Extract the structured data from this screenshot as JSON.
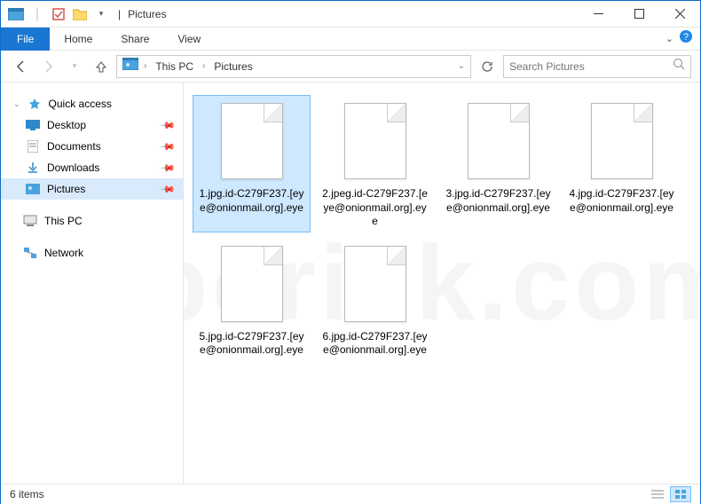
{
  "window": {
    "title": "Pictures",
    "title_sep": "|"
  },
  "ribbon": {
    "file": "File",
    "tabs": [
      "Home",
      "Share",
      "View"
    ]
  },
  "address": {
    "segments": [
      "This PC",
      "Pictures"
    ]
  },
  "search": {
    "placeholder": "Search Pictures"
  },
  "nav": {
    "quick_access": "Quick access",
    "items": [
      {
        "label": "Desktop",
        "pinned": true
      },
      {
        "label": "Documents",
        "pinned": true
      },
      {
        "label": "Downloads",
        "pinned": true
      },
      {
        "label": "Pictures",
        "pinned": true,
        "active": true
      }
    ],
    "this_pc": "This PC",
    "network": "Network"
  },
  "files": [
    {
      "name": "1.jpg.id-C279F237.[eye@onionmail.org].eye",
      "selected": true
    },
    {
      "name": "2.jpeg.id-C279F237.[eye@onionmail.org].eye"
    },
    {
      "name": "3.jpg.id-C279F237.[eye@onionmail.org].eye"
    },
    {
      "name": "4.jpg.id-C279F237.[eye@onionmail.org].eye"
    },
    {
      "name": "5.jpg.id-C279F237.[eye@onionmail.org].eye"
    },
    {
      "name": "6.jpg.id-C279F237.[eye@onionmail.org].eye"
    }
  ],
  "status": {
    "count_label": "6 items"
  },
  "watermark": "pcrisk.com"
}
